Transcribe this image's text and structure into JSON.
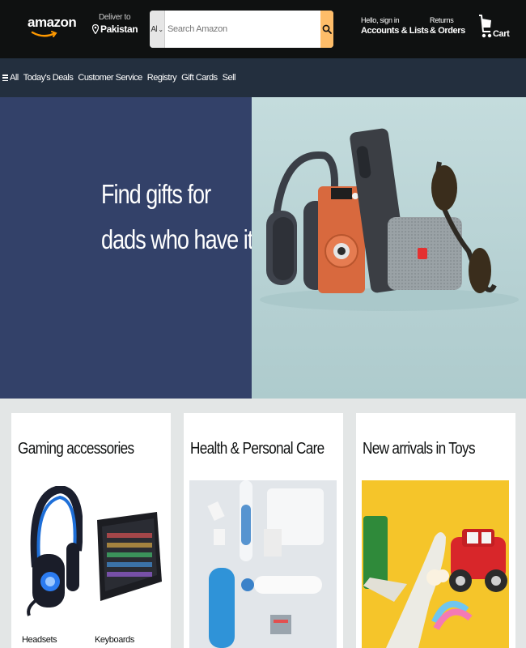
{
  "header": {
    "logo_text": "amazon",
    "deliver_line1": "Deliver to",
    "deliver_line2": "Pakistan",
    "search_category": "All",
    "search_placeholder": "Search Amazon",
    "account_line1": "Hello, sign in",
    "account_line2": "Accounts & Lists",
    "returns_line1": "Returns",
    "returns_line2": "& Orders",
    "cart_label": "Cart"
  },
  "subnav": {
    "items": [
      "All",
      "Today's Deals",
      "Customer Service",
      "Registry",
      "Gift Cards",
      "Sell"
    ]
  },
  "hero": {
    "line1": "Find gifts for",
    "line2": "dads who have it all"
  },
  "cards": [
    {
      "title": "Gaming accessories",
      "captions": [
        "Headsets",
        "Keyboards"
      ]
    },
    {
      "title": "Health & Personal Care"
    },
    {
      "title": "New arrivals in Toys"
    }
  ],
  "colors": {
    "nav_bg": "#0f1111",
    "subnav_bg": "#232f3e",
    "hero_left": "#334169",
    "search_button": "#febd69",
    "page_bg": "#e3e6e6"
  },
  "icons": [
    "location-pin-icon",
    "chevron-down-icon",
    "search-icon",
    "cart-icon",
    "hamburger-icon",
    "amazon-smile-logo"
  ]
}
